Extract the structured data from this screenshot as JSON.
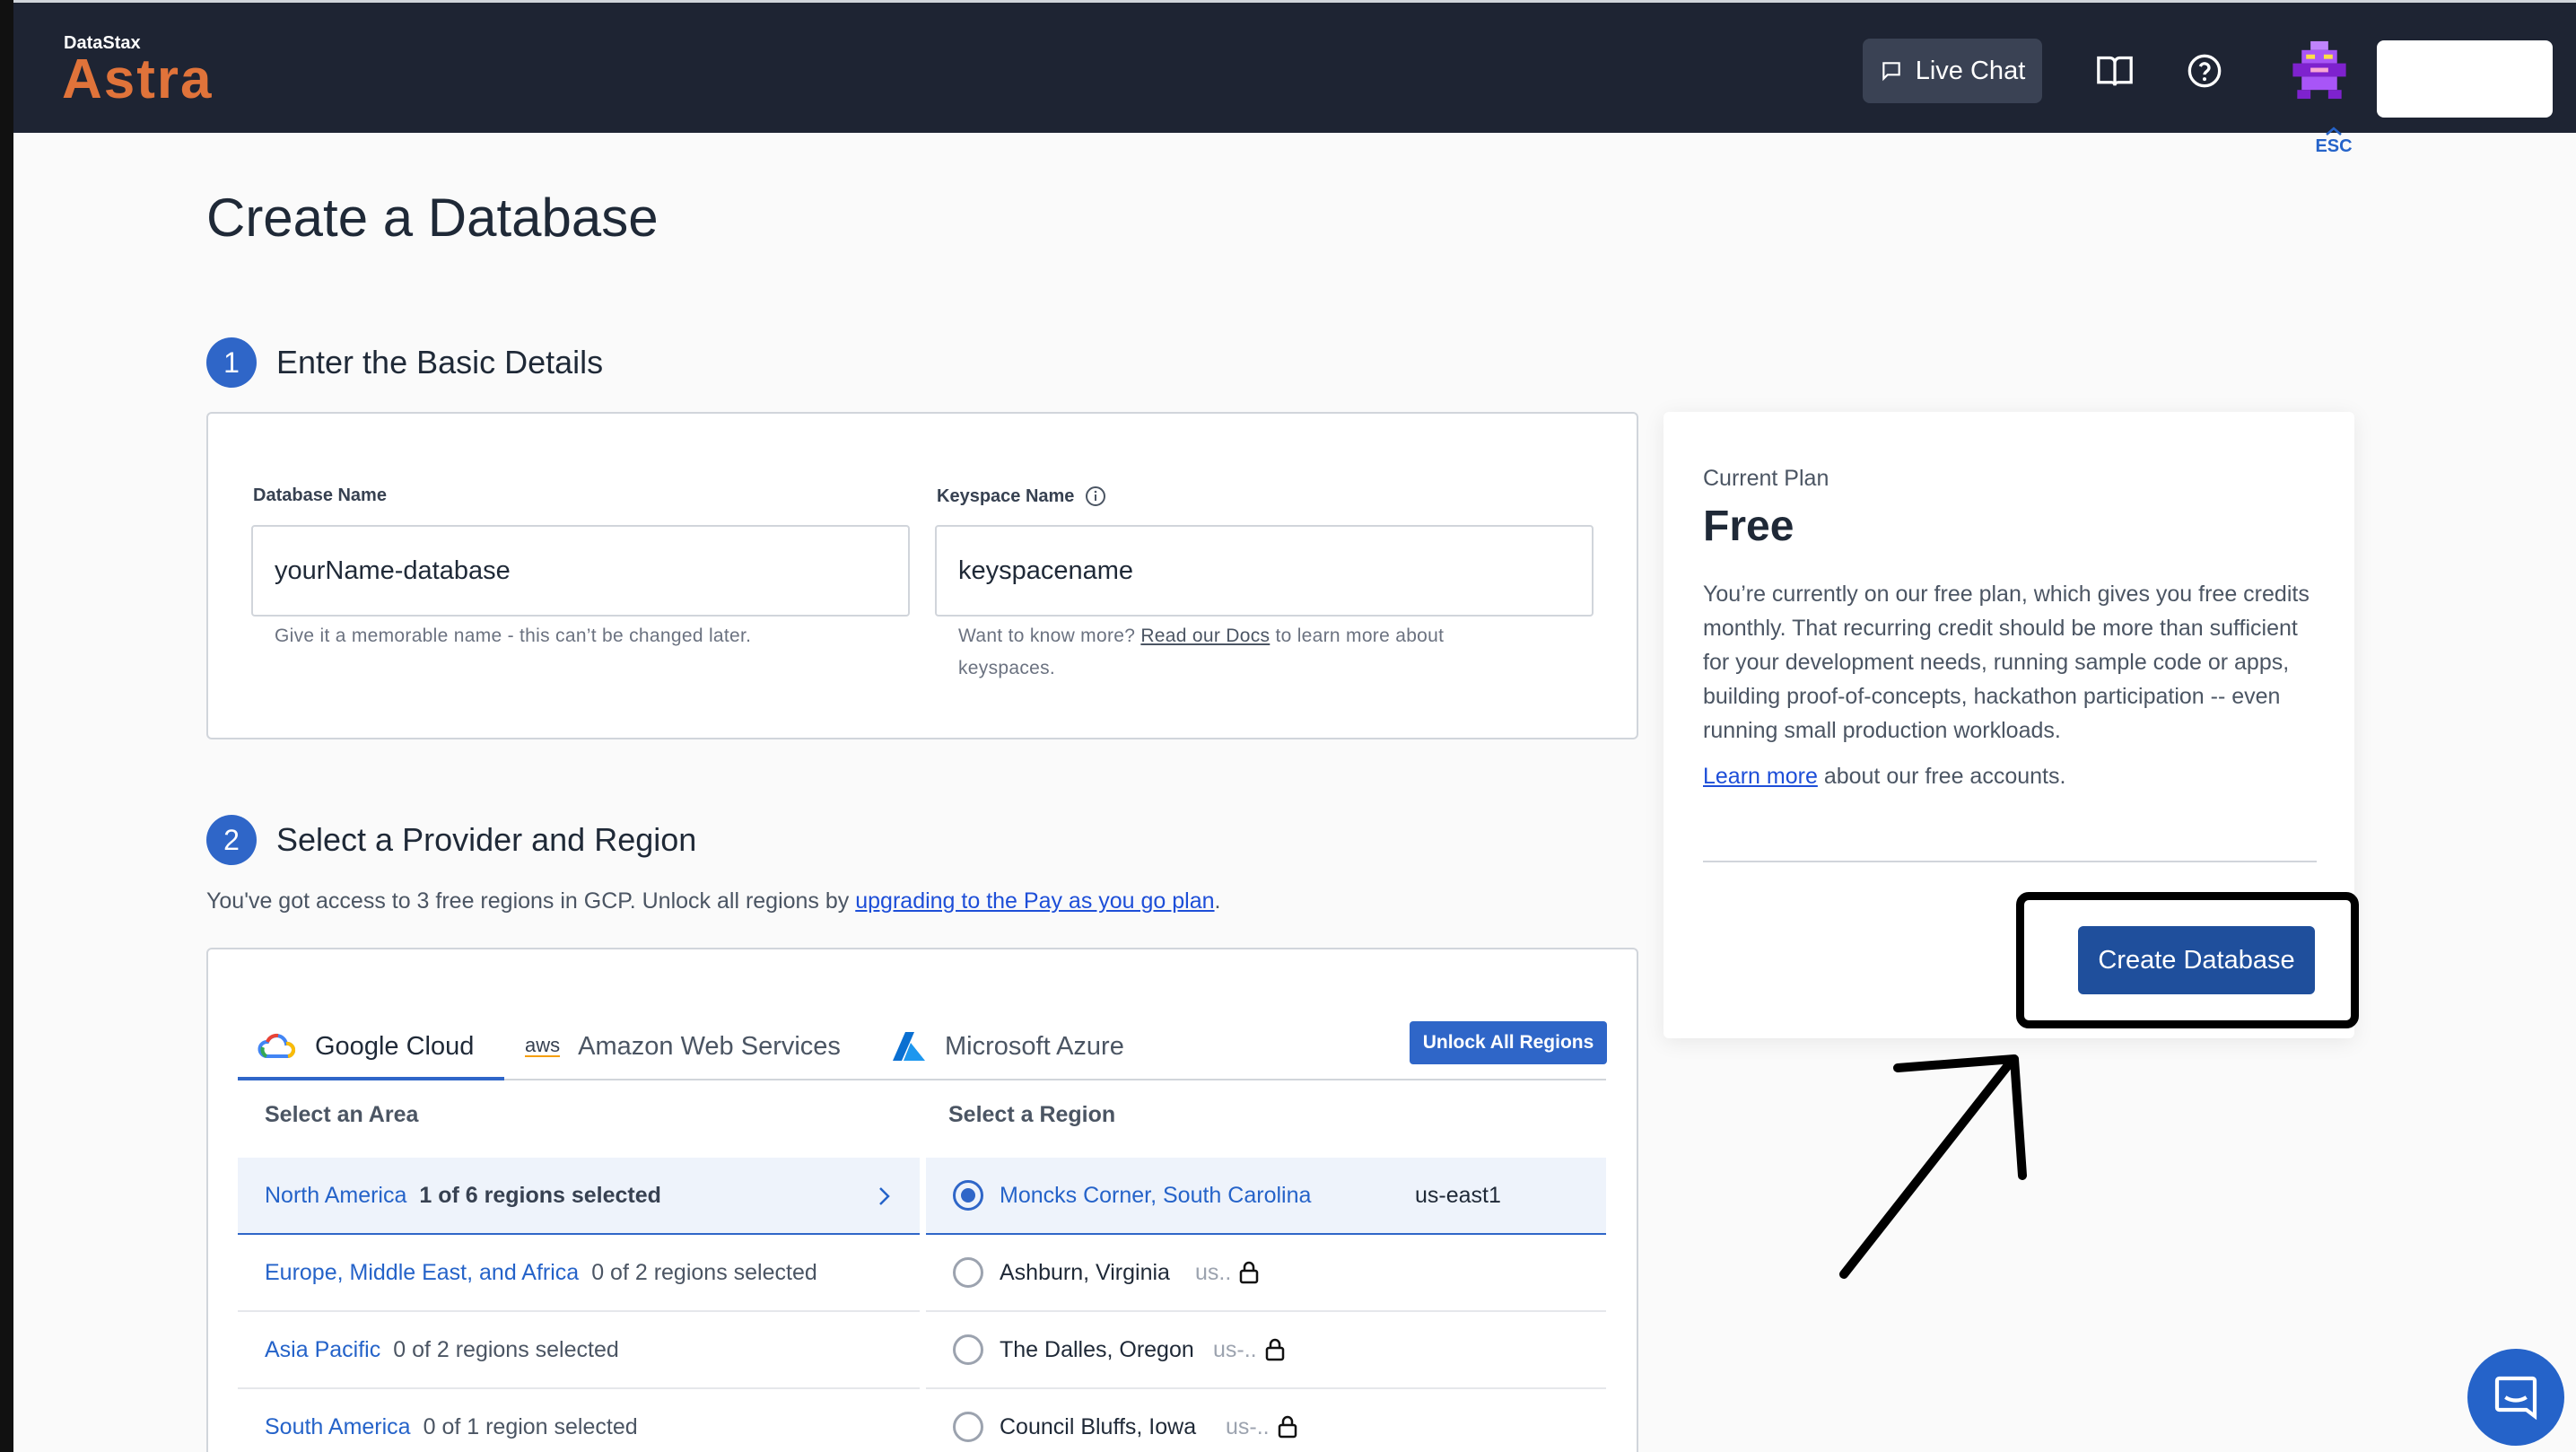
{
  "header": {
    "brand_small": "DataStax",
    "brand_big": "Astra",
    "live_chat_label": "Live Chat",
    "esc_label": "ESC"
  },
  "page": {
    "title": "Create a Database"
  },
  "step1": {
    "number": "1",
    "title": "Enter the Basic Details",
    "database_name_label": "Database Name",
    "database_name_value": "yourName-database",
    "database_name_help": "Give it a memorable name - this can’t be changed later.",
    "keyspace_name_label": "Keyspace Name",
    "keyspace_name_value": "keyspacename",
    "keyspace_help_prefix": "Want to know more?",
    "keyspace_help_link": "Read our Docs",
    "keyspace_help_suffix": "to learn more about",
    "keyspace_help_line2": "keyspaces."
  },
  "plan": {
    "label": "Current Plan",
    "name": "Free",
    "description": "You’re currently on our free plan, which gives you free credits monthly. That recurring credit should be more than sufficient for your development needs, running sample code or apps, building proof-of-concepts, hackathon participation -- even running small production workloads.",
    "learn_more_link": "Learn more",
    "learn_more_suffix": "about our free accounts.",
    "create_button": "Create Database"
  },
  "step2": {
    "number": "2",
    "title": "Select a Provider and Region",
    "subtext_prefix": "You've got access to 3 free regions in GCP. Unlock all regions by",
    "subtext_link": "upgrading to the Pay as you go plan",
    "subtext_suffix": "."
  },
  "providers": {
    "tabs": [
      {
        "label": "Google Cloud",
        "icon": "google-cloud-icon",
        "active": true
      },
      {
        "label": "Amazon Web Services",
        "icon": "aws-icon",
        "icon_text": "aws",
        "active": false
      },
      {
        "label": "Microsoft Azure",
        "icon": "azure-icon",
        "active": false
      }
    ],
    "unlock_button": "Unlock All Regions"
  },
  "areas": {
    "header": "Select an Area",
    "items": [
      {
        "name": "North America",
        "count": "1 of 6 regions selected",
        "selected": true
      },
      {
        "name": "Europe, Middle East, and Africa",
        "count": "0 of 2 regions selected",
        "selected": false
      },
      {
        "name": "Asia Pacific",
        "count": "0 of 2 regions selected",
        "selected": false
      },
      {
        "name": "South America",
        "count": "0 of 1 region selected",
        "selected": false
      }
    ]
  },
  "regions": {
    "header": "Select a Region",
    "items": [
      {
        "name": "Moncks Corner, South Carolina",
        "code": "us-east1",
        "selected": true,
        "locked": false
      },
      {
        "name": "Ashburn, Virginia",
        "code": "us..",
        "selected": false,
        "locked": true
      },
      {
        "name": "The Dalles, Oregon",
        "code": "us-..",
        "selected": false,
        "locked": true
      },
      {
        "name": "Council Bluffs, Iowa",
        "code": "us-..",
        "selected": false,
        "locked": true
      }
    ]
  },
  "colors": {
    "header_bg": "#1e2433",
    "brand_orange": "#e0733a",
    "primary_blue": "#2f66c8",
    "create_button_bg": "#1f4f9c"
  }
}
